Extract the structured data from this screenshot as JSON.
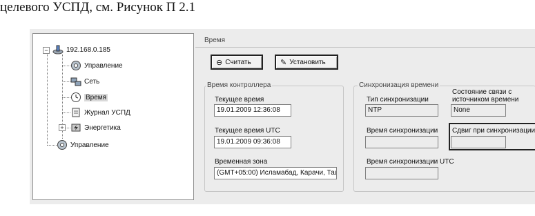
{
  "doc_text": "целевого УСПД, см. Рисунок П 2.1",
  "tree": {
    "items": [
      {
        "label": "192.168.0.185",
        "icon": "network-device-icon"
      },
      {
        "label": "Управление",
        "icon": "gear-icon"
      },
      {
        "label": "Сеть",
        "icon": "network-icon"
      },
      {
        "label": "Время",
        "icon": "clock-icon"
      },
      {
        "label": "Журнал УСПД",
        "icon": "log-icon"
      },
      {
        "label": "Энергетика",
        "icon": "energy-icon"
      },
      {
        "label": "Управление",
        "icon": "gear-icon"
      }
    ]
  },
  "pane": {
    "title": "Время",
    "read_button": "Считать",
    "set_button": "Установить"
  },
  "controller_time": {
    "legend": "Время контроллера",
    "current_time_label": "Текущее время",
    "current_time_value": "19.01.2009 12:36:08",
    "current_utc_label": "Текущее время UTC",
    "current_utc_value": "19.01.2009 09:36:08",
    "timezone_label": "Временная зона",
    "timezone_value": "(GMT+05:00) Исламабад, Карачи, Таш"
  },
  "sync": {
    "legend": "Синхронизация времени",
    "sync_type_label": "Тип синхронизации",
    "sync_type_value": "NTP",
    "link_state_label_1": "Состояние связи с",
    "link_state_label_2": "источником времени",
    "link_state_value": "None",
    "sync_time_label": "Время синхронизации",
    "sync_time_value": "",
    "shift_label": "Сдвиг при синхронизации",
    "shift_value": "",
    "sync_utc_label": "Время синхронизации UTC",
    "sync_utc_value": ""
  }
}
